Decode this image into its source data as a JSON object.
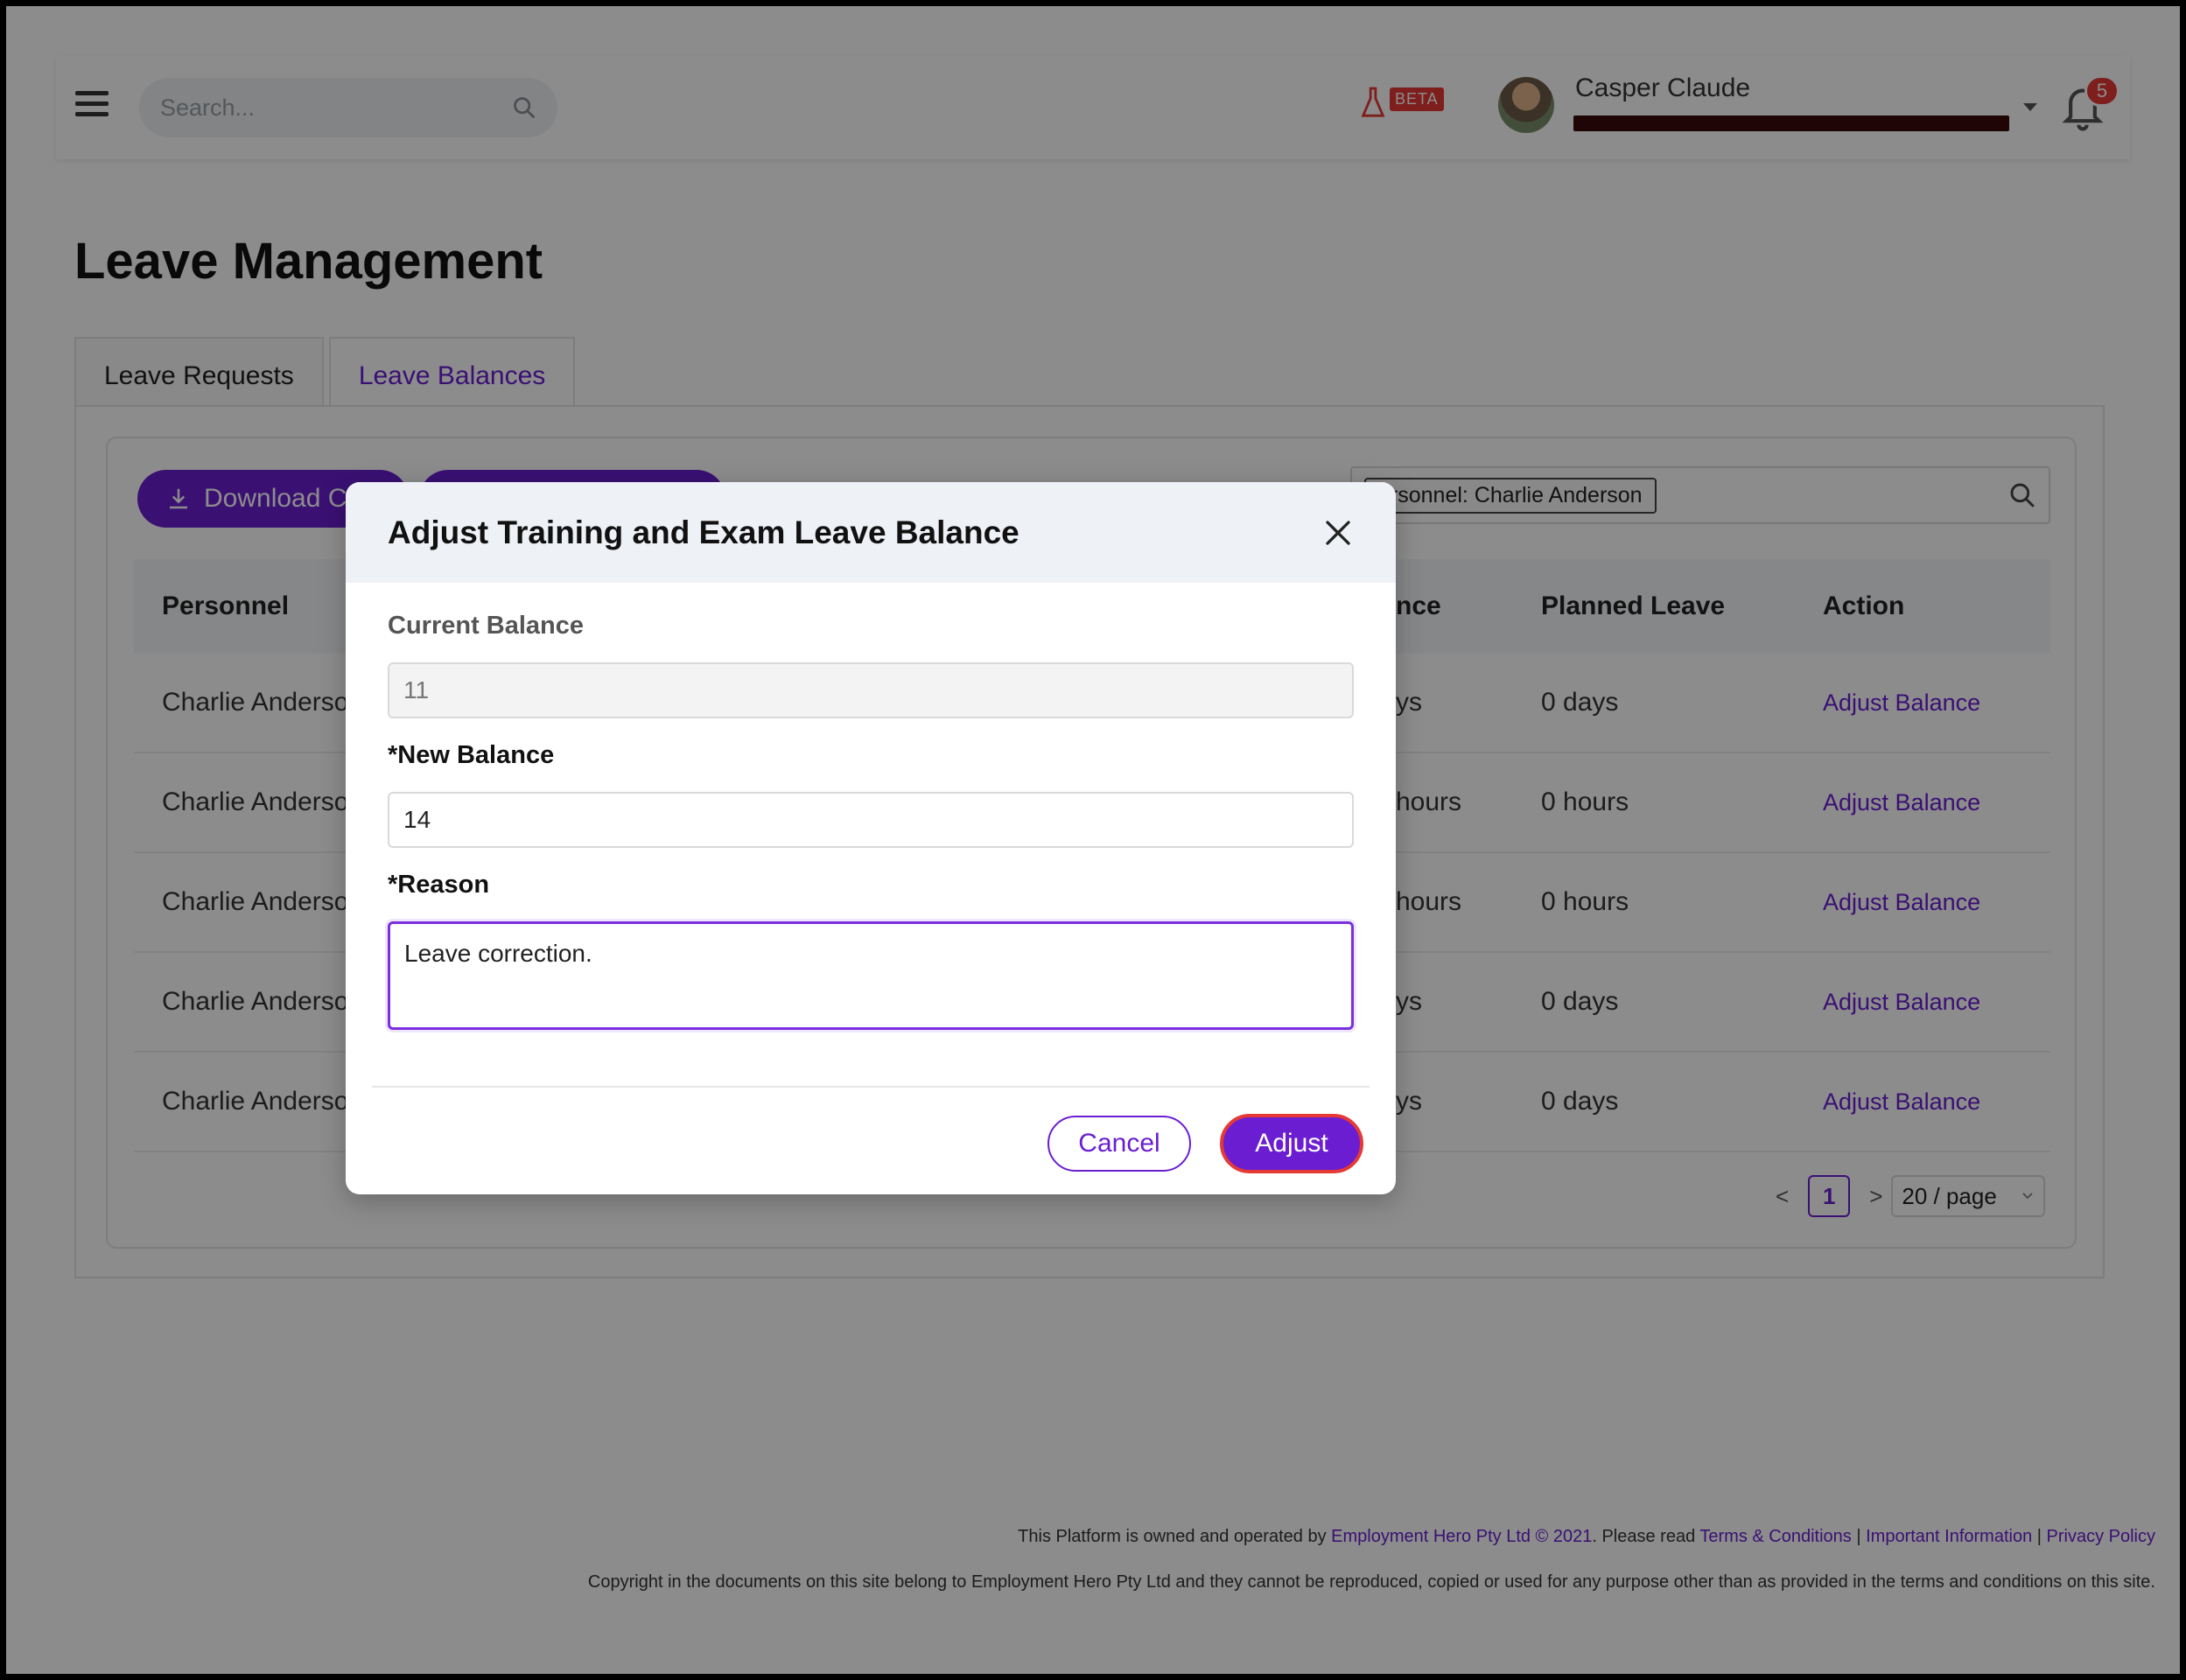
{
  "header": {
    "search_placeholder": "Search...",
    "beta_label": "BETA",
    "user_name": "Casper Claude",
    "user_subtitle": "",
    "notification_count": "5"
  },
  "page": {
    "title": "Leave Management",
    "tabs": [
      {
        "label": "Leave Requests",
        "active": false
      },
      {
        "label": "Leave Balances",
        "active": true
      }
    ]
  },
  "toolbar": {
    "download_label": "Download C",
    "second_button_label": ""
  },
  "filter": {
    "tag": "ersonnel: Charlie Anderson"
  },
  "table": {
    "headers": [
      "Personnel",
      "nce",
      "Planned Leave",
      "Action"
    ],
    "rows": [
      {
        "personnel": "Charlie Anderso",
        "balance": "ys",
        "planned": "0 days",
        "action": "Adjust Balance"
      },
      {
        "personnel": "Charlie Anderso",
        "balance": "hours",
        "planned": "0 hours",
        "action": "Adjust Balance"
      },
      {
        "personnel": "Charlie Anderso",
        "balance": "hours",
        "planned": "0 hours",
        "action": "Adjust Balance"
      },
      {
        "personnel": "Charlie Anderso",
        "balance": "ys",
        "planned": "0 days",
        "action": "Adjust Balance"
      },
      {
        "personnel": "Charlie Anderso",
        "balance": "ys",
        "planned": "0 days",
        "action": "Adjust Balance"
      }
    ]
  },
  "pagination": {
    "prev": "<",
    "current": "1",
    "next": ">",
    "page_size": "20 / page"
  },
  "footer": {
    "line1_prefix": "This Platform is owned and operated by ",
    "company_link": "Employment Hero Pty Ltd © 2021",
    "line1_mid": ". Please read ",
    "terms_link": "Terms & Conditions",
    "sep": " | ",
    "info_link": "Important Information",
    "privacy_link": "Privacy Policy",
    "line2": "Copyright in the documents on this site belong to Employment Hero Pty Ltd and they cannot be reproduced, copied or used for any purpose other than as provided in the terms and conditions on this site."
  },
  "modal": {
    "title": "Adjust Training and Exam Leave Balance",
    "current_label": "Current Balance",
    "current_value": "11",
    "new_label": "*New Balance",
    "new_value": "14",
    "reason_label": "*Reason",
    "reason_value": "Leave correction.",
    "cancel_label": "Cancel",
    "adjust_label": "Adjust"
  },
  "colors": {
    "accent": "#6b1ed1",
    "danger": "#e53935"
  }
}
